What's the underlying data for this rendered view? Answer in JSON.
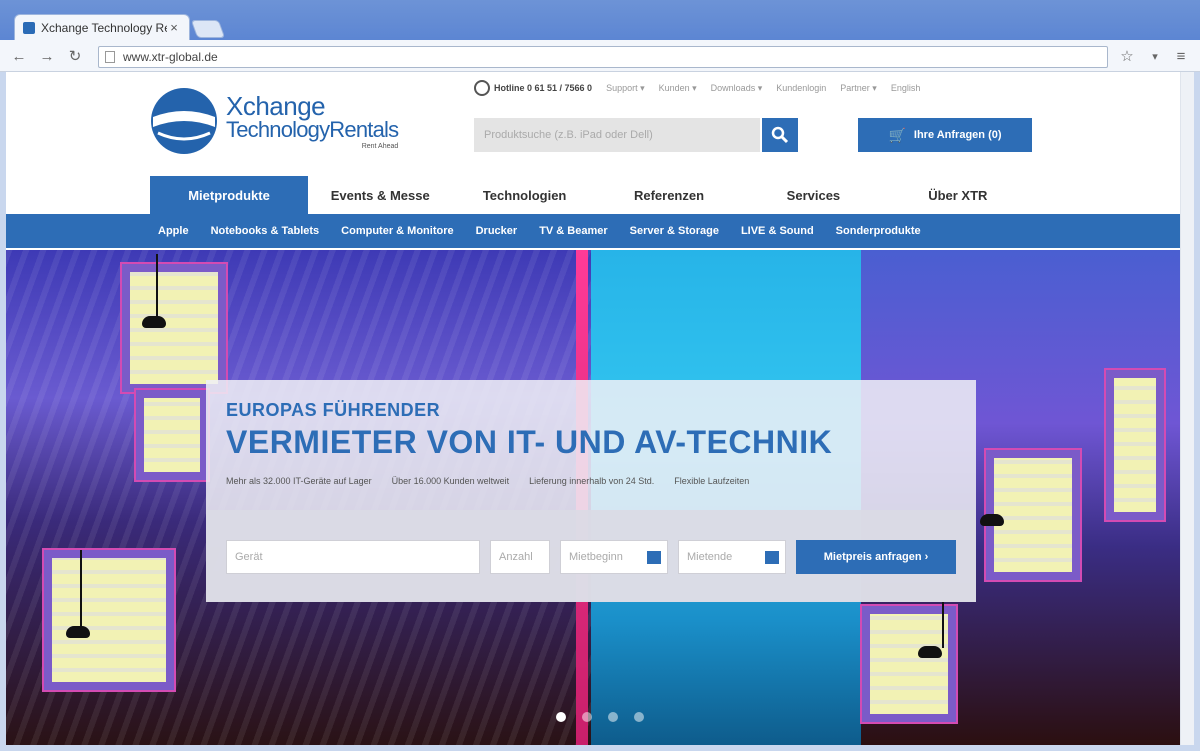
{
  "browser": {
    "tab_title": "Xchange Technology Re",
    "close_glyph": "×",
    "url": "www.xtr-global.de",
    "back_glyph": "←",
    "forward_glyph": "→",
    "reload_glyph": "↻",
    "star_glyph": "☆",
    "menu_glyph": "≡"
  },
  "logo": {
    "line1": "Xchange",
    "line2": "TechnologyRentals",
    "line3": "Rent Ahead"
  },
  "topbar": {
    "hotline": "Hotline 0 61 51 / 7566 0",
    "links": [
      "Support ▾",
      "Kunden ▾",
      "Downloads ▾",
      "Kundenlogin",
      "Partner ▾",
      "English"
    ]
  },
  "search": {
    "placeholder": "Produktsuche (z.B. iPad oder Dell)"
  },
  "request_button": {
    "icon": "🛒",
    "label": "Ihre Anfragen (0)"
  },
  "main_nav": [
    "Mietprodukte",
    "Events & Messe",
    "Technologien",
    "Referenzen",
    "Services",
    "Über XTR"
  ],
  "sub_nav": [
    "Apple",
    "Notebooks & Tablets",
    "Computer & Monitore",
    "Drucker",
    "TV & Beamer",
    "Server & Storage",
    "LIVE & Sound",
    "Sonderprodukte"
  ],
  "hero": {
    "subtitle": "EUROPAS FÜHRENDER",
    "title": "VERMIETER VON IT- UND AV-TECHNIK",
    "facts": [
      "Mehr als 32.000 IT-Geräte auf Lager",
      "Über 16.000 Kunden weltweit",
      "Lieferung innerhalb von 24 Std.",
      "Flexible Laufzeiten"
    ],
    "form": {
      "product_placeholder": "Gerät",
      "qty_placeholder": "Anzahl",
      "from_placeholder": "Mietbeginn",
      "to_placeholder": "Mietende",
      "submit_label": "Mietpreis anfragen  ›"
    },
    "slide_count": 4,
    "active_slide": 1
  }
}
